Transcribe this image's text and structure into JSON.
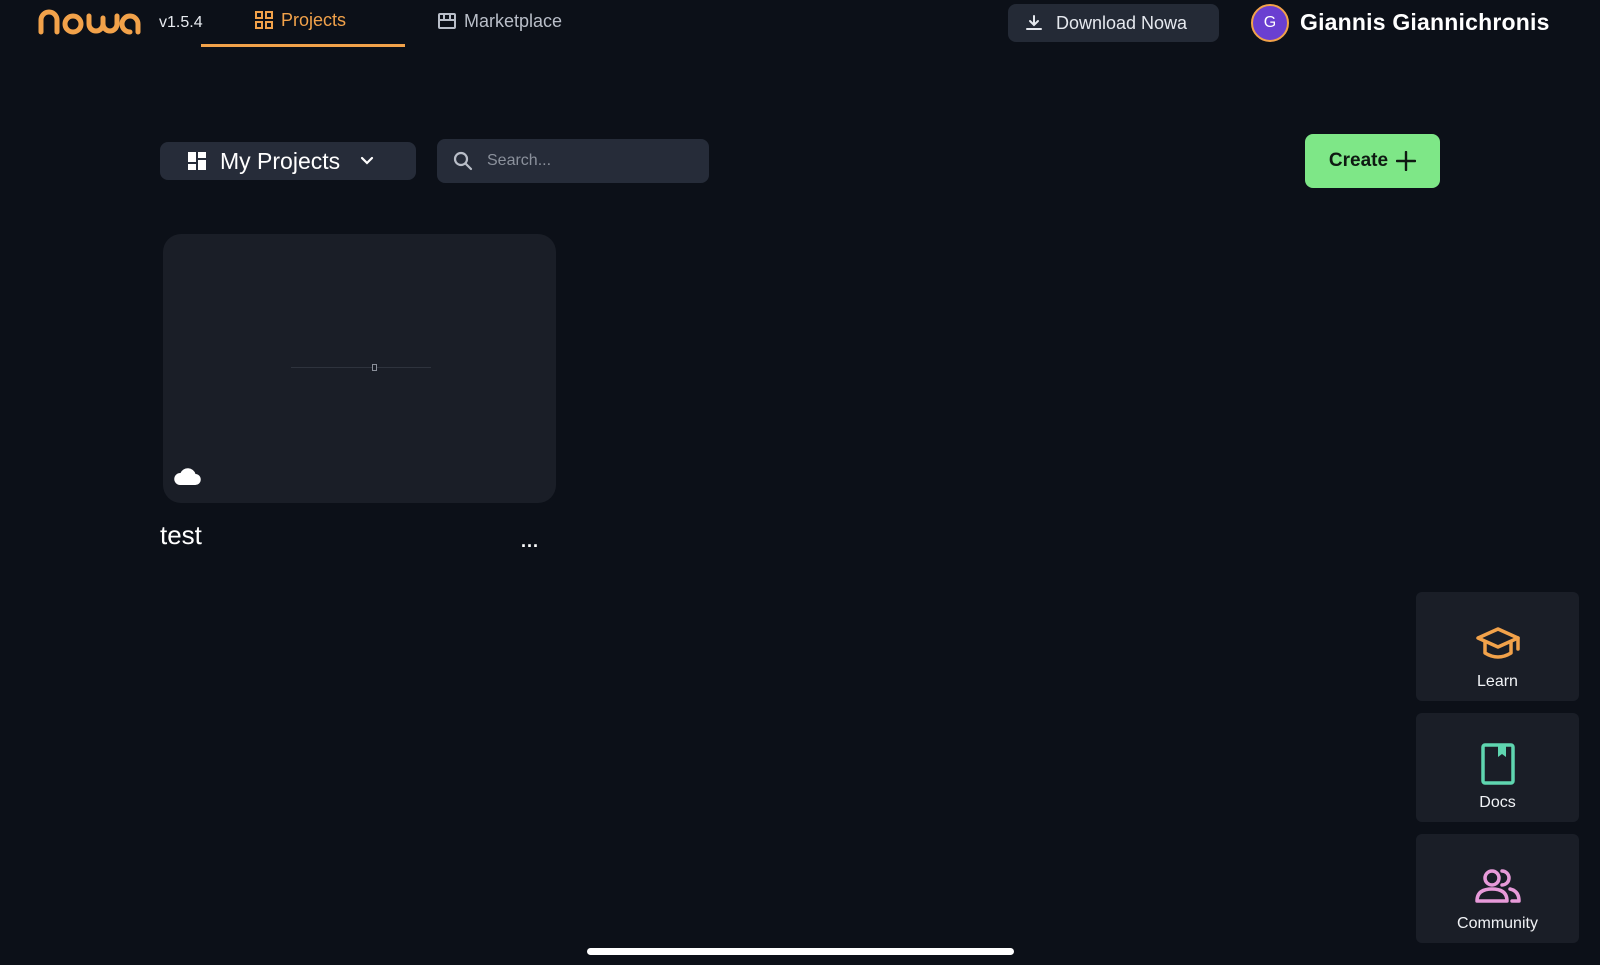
{
  "header": {
    "logo_text": "nowa",
    "version": "v1.5.4",
    "tabs": [
      {
        "label": "Projects",
        "icon": "grid-icon",
        "active": true
      },
      {
        "label": "Marketplace",
        "icon": "store-icon",
        "active": false
      }
    ],
    "download_label": "Download Nowa",
    "user": {
      "initial": "G",
      "name": "Giannis Giannichronis"
    }
  },
  "toolbar": {
    "projects_filter": "My Projects",
    "search_placeholder": "Search...",
    "create_label": "Create"
  },
  "projects": [
    {
      "name": "test",
      "storage": "cloud-icon",
      "more": "..."
    }
  ],
  "side_panel": [
    {
      "label": "Learn",
      "icon": "graduation-cap-icon",
      "color": "#f2a24a"
    },
    {
      "label": "Docs",
      "icon": "book-icon",
      "color": "#5fd6b0"
    },
    {
      "label": "Community",
      "icon": "users-icon",
      "color": "#e79ad9"
    }
  ],
  "colors": {
    "background": "#0c1018",
    "accent": "#f2a24a",
    "create": "#7ee787",
    "surface": "#262c39"
  }
}
